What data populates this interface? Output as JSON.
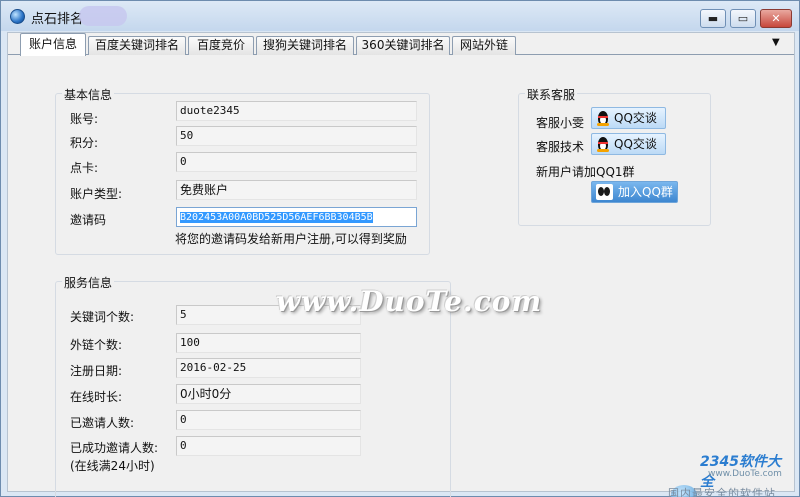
{
  "window": {
    "title": "点石排名",
    "buttons": {
      "minimize": "▬",
      "maximize": "▭",
      "close": "✕"
    }
  },
  "tabs": [
    {
      "label": "账户信息",
      "active": true
    },
    {
      "label": "百度关键词排名",
      "active": false
    },
    {
      "label": "百度竞价",
      "active": false
    },
    {
      "label": "搜狗关键词排名",
      "active": false
    },
    {
      "label": "360关键词排名",
      "active": false
    },
    {
      "label": "网站外链",
      "active": false
    }
  ],
  "tab_overflow_icon": "▼",
  "basic_info": {
    "title": "基本信息",
    "account_label": "账号:",
    "account_value": "duote2345",
    "points_label": "积分:",
    "points_value": "50",
    "card_label": "点卡:",
    "card_value": "0",
    "type_label": "账户类型:",
    "type_value": "免费账户",
    "invite_label": "邀请码",
    "invite_value": "B202453A00A0BD525D56AEF6BB304B5B",
    "invite_hint": "将您的邀请码发给新用户注册,可以得到奖励"
  },
  "contact": {
    "title": "联系客服",
    "service1_label": "客服小雯",
    "service1_button": "QQ交谈",
    "service2_label": "客服技术",
    "service2_button": "QQ交谈",
    "group_hint": "新用户请加QQ1群",
    "join_button": "加入QQ群"
  },
  "service_info": {
    "title": "服务信息",
    "keywords_label": "关键词个数:",
    "keywords_value": "5",
    "links_label": "外链个数:",
    "links_value": "100",
    "regdate_label": "注册日期:",
    "regdate_value": "2016-02-25",
    "online_label": "在线时长:",
    "online_value": "0小时0分",
    "invited_label": "已邀请人数:",
    "invited_value": "0",
    "success_label": "已成功邀请人数:",
    "success_note": "(在线满24小时)",
    "success_value": "0"
  },
  "watermarks": {
    "duote": "www.DuoTe.com",
    "logo_2345": "2345软件大全",
    "url_2345": "www.DuoTe.com",
    "slogan_2345": "国内最安全的软件站"
  },
  "colors": {
    "title_bar": "#c4d7ed",
    "close_button": "#c7473b",
    "selection": "#3399ff",
    "qq_button": "#bcdaf6",
    "join_button": "#3d86d0"
  }
}
